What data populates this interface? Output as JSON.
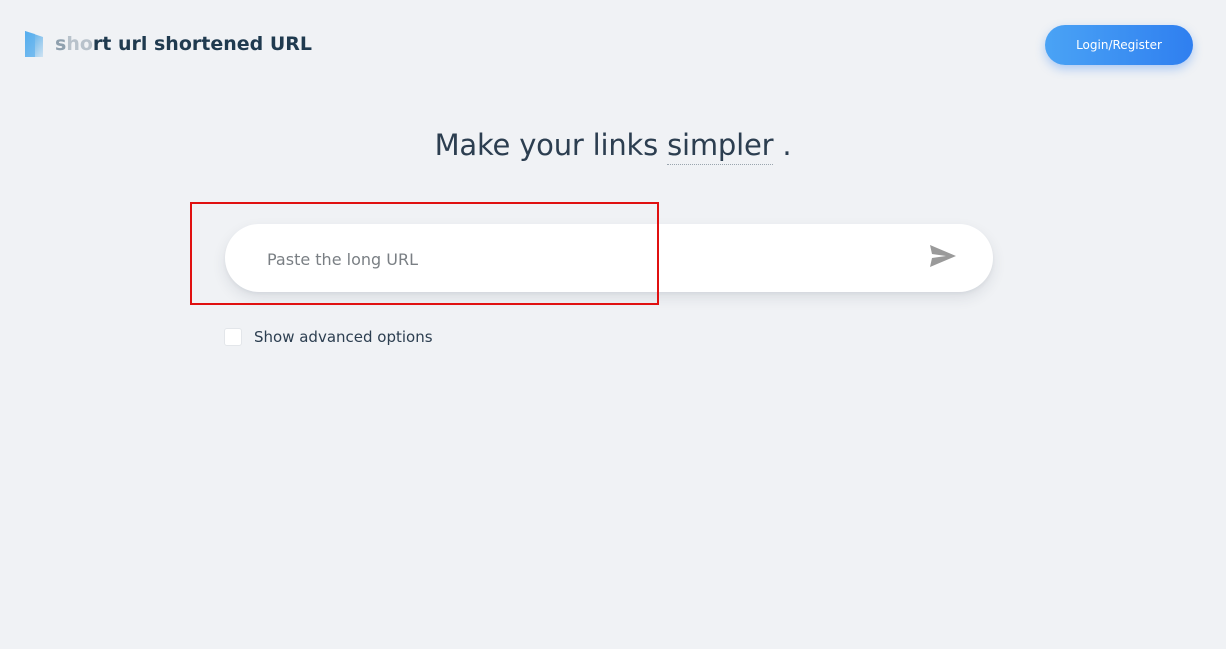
{
  "header": {
    "logo_text_part1": "s",
    "logo_text_part2": "h",
    "logo_text_part3": "o",
    "logo_text_part4": "rt url shortened URL",
    "login_label": "Login/Register"
  },
  "hero": {
    "text_before": "Make your links ",
    "highlight_word": "simpler",
    "text_after": " ."
  },
  "search": {
    "placeholder": "Paste the long URL",
    "value": ""
  },
  "options": {
    "advanced_label": "Show advanced options",
    "advanced_checked": false
  },
  "colors": {
    "background": "#f0f2f5",
    "accent": "#2f7ff0",
    "highlight_border": "#e01010"
  },
  "icons": {
    "logo": "logo-icon",
    "send": "send-icon"
  }
}
